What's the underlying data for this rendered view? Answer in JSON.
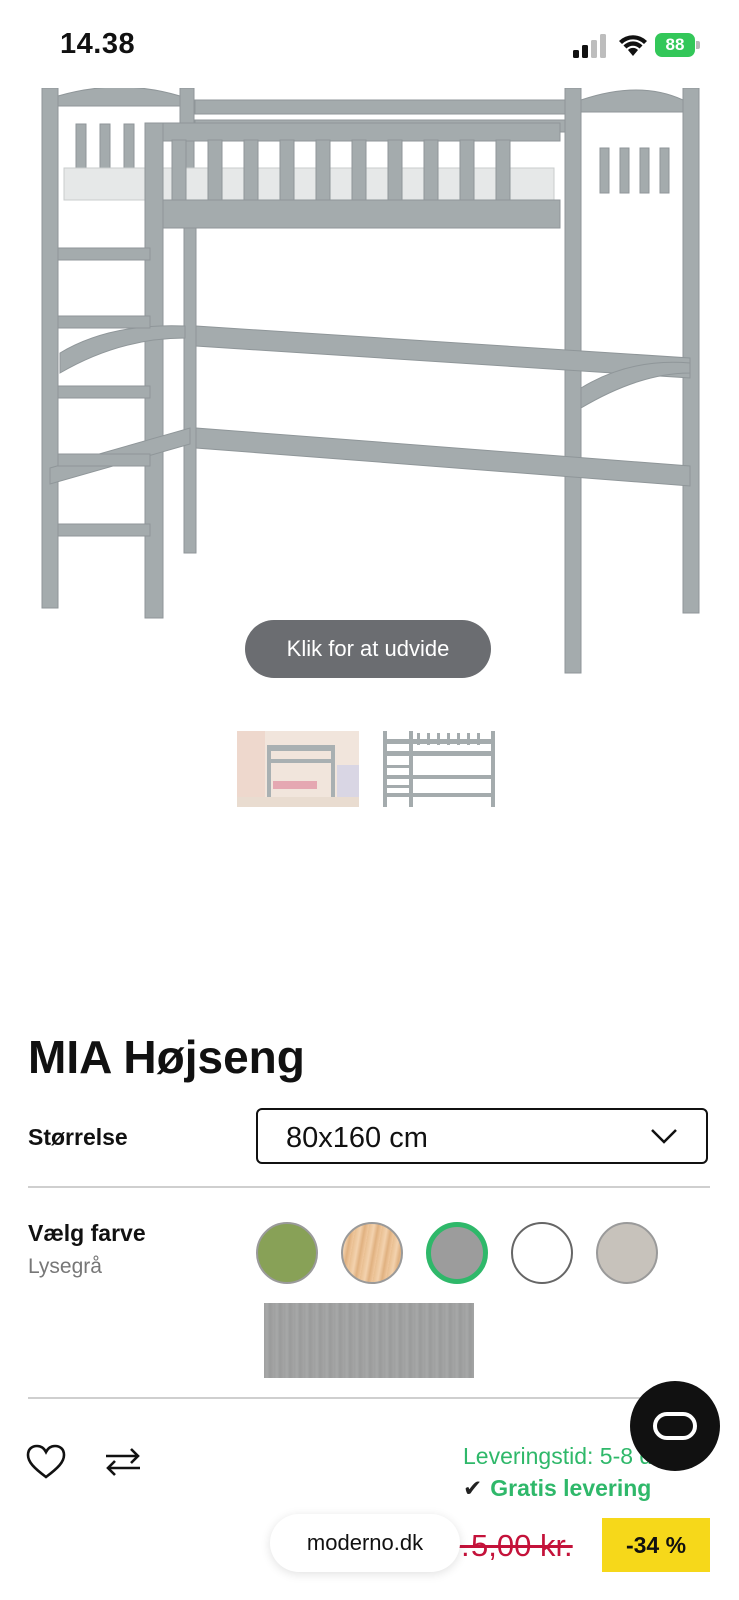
{
  "status_bar": {
    "time": "14.38",
    "battery": "88"
  },
  "gallery": {
    "expand_label": "Klik for at udvide"
  },
  "product": {
    "title": "MIA Højseng",
    "size_label": "Størrelse",
    "size_value": "80x160 cm",
    "color_label": "Vælg farve",
    "color_value": "Lysegrå",
    "swatches": [
      {
        "name": "green",
        "color": "#88a157"
      },
      {
        "name": "pine",
        "color": "#f0c89e"
      },
      {
        "name": "light-grey",
        "color": "#9c9c9c",
        "selected": true
      },
      {
        "name": "white",
        "color": "#ffffff"
      },
      {
        "name": "beige-grey",
        "color": "#c7c2bb"
      }
    ]
  },
  "delivery": {
    "time_text": "Leveringstid: 5-8 d...",
    "free_text": "Gratis levering"
  },
  "price": {
    "old_price": "…5,00 kr.",
    "discount": "-34 %"
  },
  "browser": {
    "domain": "moderno.dk"
  },
  "colors": {
    "accent_green": "#2fb86a",
    "price_red": "#c4123a",
    "discount_yellow": "#f6d81a"
  }
}
